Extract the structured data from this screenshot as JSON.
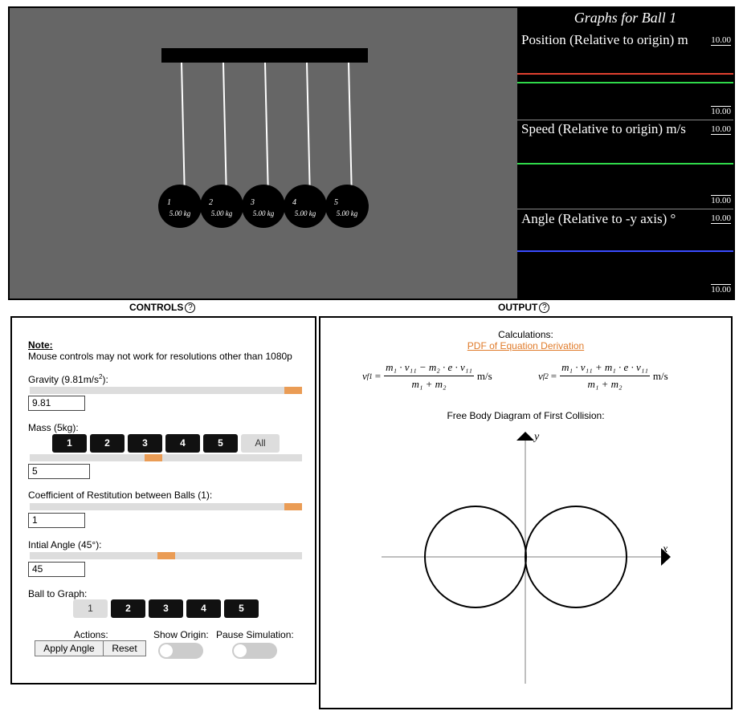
{
  "simulation": {
    "balls": [
      {
        "number": "1",
        "mass": "5.00 kg"
      },
      {
        "number": "2",
        "mass": "5.00 kg"
      },
      {
        "number": "3",
        "mass": "5.00 kg"
      },
      {
        "number": "4",
        "mass": "5.00 kg"
      },
      {
        "number": "5",
        "mass": "5.00 kg"
      }
    ]
  },
  "graphs": {
    "title": "Graphs for Ball 1",
    "plots": [
      {
        "label": "Position (Relative to origin) m",
        "top_tick": "10.00",
        "bottom_tick": "10.00",
        "line_colors": [
          "#e0402f",
          "#2fd94a"
        ]
      },
      {
        "label": "Speed (Relative to origin) m/s",
        "top_tick": "10.00",
        "bottom_tick": "10.00",
        "line_colors": [
          "#2fd94a"
        ]
      },
      {
        "label": "Angle (Relative to -y axis) °",
        "top_tick": "10.00",
        "bottom_tick": "10.00",
        "line_colors": [
          "#3a4bff"
        ]
      }
    ]
  },
  "controls": {
    "header": "CONTROLS",
    "help_glyph": "?",
    "note_title": "Note:",
    "note_text": "Mouse controls may not work for resolutions other than 1080p",
    "gravity": {
      "label_prefix": "Gravity (9.81m/s",
      "label_sup": "2",
      "label_suffix": "):",
      "value": "9.81",
      "slider_fraction": 1.0
    },
    "mass": {
      "label": "Mass (5kg):",
      "buttons": [
        "1",
        "2",
        "3",
        "4",
        "5",
        "All"
      ],
      "value": "5",
      "slider_fraction": 0.45
    },
    "restitution": {
      "label": "Coefficient of Restitution between Balls (1):",
      "value": "1",
      "slider_fraction": 1.0
    },
    "angle": {
      "label": "Intial Angle (45°):",
      "value": "45",
      "slider_fraction": 0.5
    },
    "ball_to_graph": {
      "label": "Ball to Graph:",
      "buttons": [
        "1",
        "2",
        "3",
        "4",
        "5"
      ],
      "selected": "1"
    },
    "actions": {
      "label": "Actions:",
      "apply_label": "Apply Angle",
      "reset_label": "Reset"
    },
    "show_origin": {
      "label": "Show Origin:",
      "on": false
    },
    "pause": {
      "label": "Pause Simulation:",
      "on": false
    }
  },
  "output": {
    "header": "OUTPUT",
    "help_glyph": "?",
    "calc_label": "Calculations:",
    "pdf_link": "PDF of Equation Derivation",
    "eq1": {
      "lhs": "v",
      "lhs_sub": "f1",
      "num": "m₁ · v₁₁ − m₂ · e · v₁₁",
      "den": "m₁ + m₂",
      "unit": "m/s"
    },
    "eq2": {
      "lhs": "v",
      "lhs_sub": "f2",
      "num": "m₁ · v₁₁ + m₁ · e · v₁₁",
      "den": "m₁ + m₂",
      "unit": "m/s"
    },
    "fbd_title": "Free Body Diagram of First Collision:",
    "axis_x": "x",
    "axis_y": "y"
  }
}
